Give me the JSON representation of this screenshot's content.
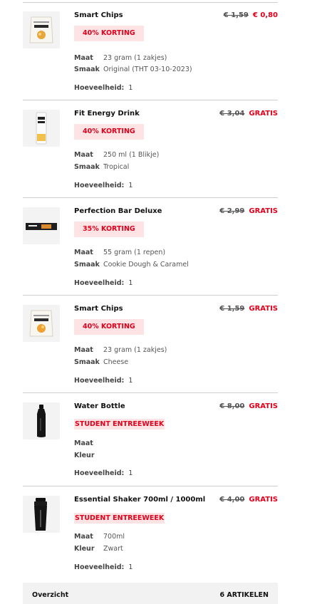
{
  "labels": {
    "size": "Maat",
    "flavor": "Smaak",
    "color": "Kleur",
    "quantity": "Hoeveelheid:"
  },
  "items": [
    {
      "name": "Smart Chips",
      "old_price": "€ 1,59",
      "new_price": "€ 0,80",
      "badge": "40% KORTING",
      "size": "23 gram (1 zakjes)",
      "flavor": "Original (THT 03-10-2023)",
      "quantity": "1",
      "image_icon": "chips-bag-icon"
    },
    {
      "name": "Fit Energy Drink",
      "old_price": "€ 3,04",
      "new_price": "GRATIS",
      "badge": "40% KORTING",
      "size": "250 ml (1 Blikje)",
      "flavor": "Tropical",
      "quantity": "1",
      "image_icon": "energy-drink-can-icon"
    },
    {
      "name": "Perfection Bar Deluxe",
      "old_price": "€ 2,99",
      "new_price": "GRATIS",
      "badge": "35% KORTING",
      "size": "55 gram (1 repen)",
      "flavor": "Cookie Dough & Caramel",
      "quantity": "1",
      "image_icon": "protein-bar-icon"
    },
    {
      "name": "Smart Chips",
      "old_price": "€ 1,59",
      "new_price": "GRATIS",
      "badge": "40% KORTING",
      "size": "23 gram (1 zakjes)",
      "flavor": "Cheese",
      "quantity": "1",
      "image_icon": "chips-bag-icon"
    },
    {
      "name": "Water Bottle",
      "old_price": "€ 8,00",
      "new_price": "GRATIS",
      "badge": "STUDENT ENTREEWEEK",
      "size": "",
      "color": "",
      "quantity": "1",
      "image_icon": "water-bottle-icon"
    },
    {
      "name": "Essential Shaker 700ml / 1000ml",
      "old_price": "€ 4,00",
      "new_price": "GRATIS",
      "badge": "STUDENT ENTREEWEEK",
      "size": "700ml",
      "color": "Zwart",
      "quantity": "1",
      "image_icon": "shaker-icon"
    }
  ],
  "summary": {
    "label": "Overzicht",
    "count": "6 ARTIKELEN"
  },
  "colors": {
    "accent": "#e3001b",
    "badge_bg": "#fde3e3",
    "divider": "#cfcfcf",
    "summary_bg": "#f2f2f2"
  }
}
